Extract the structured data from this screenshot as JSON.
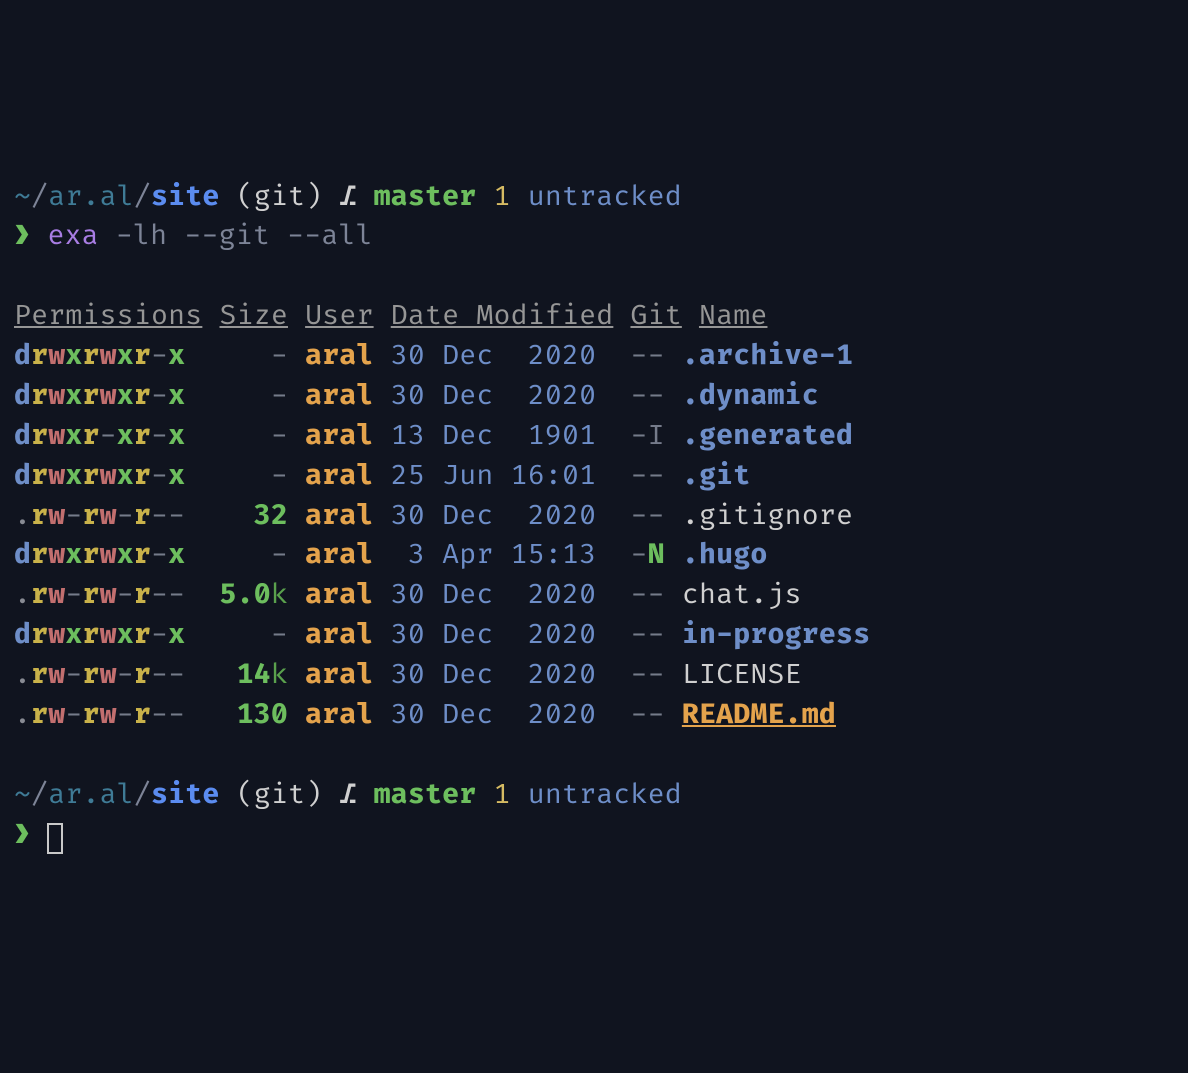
{
  "prompt1": {
    "tilde": "~",
    "slash1": "/",
    "path_mid": "ar.al",
    "slash2": "/",
    "dir": "site",
    "lparen": " (",
    "git": "git",
    "rparen": ")",
    "branch_icon": " ⎇ ",
    "branch": "master",
    "count": " 1 ",
    "untracked": "untracked"
  },
  "command": {
    "chevron": "❯",
    "exa": "exa",
    "flags": " -lh --git --all"
  },
  "headers": {
    "perm": "Permissions",
    "size": "Size",
    "user": "User",
    "date": "Date Modified",
    "git": "Git",
    "name": "Name"
  },
  "rows": [
    {
      "perm": "drwxrwxr-x",
      "size": "-",
      "unit": "",
      "user": "aral",
      "date": "30 Dec  2020",
      "git": "--",
      "name": ".archive-1",
      "kind": "dir"
    },
    {
      "perm": "drwxrwxr-x",
      "size": "-",
      "unit": "",
      "user": "aral",
      "date": "30 Dec  2020",
      "git": "--",
      "name": ".dynamic",
      "kind": "dir"
    },
    {
      "perm": "drwxr-xr-x",
      "size": "-",
      "unit": "",
      "user": "aral",
      "date": "13 Dec  1901",
      "git": "-I",
      "name": ".generated",
      "kind": "dir"
    },
    {
      "perm": "drwxrwxr-x",
      "size": "-",
      "unit": "",
      "user": "aral",
      "date": "25 Jun 16:01",
      "git": "--",
      "name": ".git",
      "kind": "dir"
    },
    {
      "perm": ".rw-rw-r--",
      "size": "32",
      "unit": "",
      "user": "aral",
      "date": "30 Dec  2020",
      "git": "--",
      "name": ".gitignore",
      "kind": "file"
    },
    {
      "perm": "drwxrwxr-x",
      "size": "-",
      "unit": "",
      "user": "aral",
      "date": " 3 Apr 15:13",
      "git": "-N",
      "name": ".hugo",
      "kind": "dir"
    },
    {
      "perm": ".rw-rw-r--",
      "size": "5.0",
      "unit": "k",
      "user": "aral",
      "date": "30 Dec  2020",
      "git": "--",
      "name": "chat.js",
      "kind": "file"
    },
    {
      "perm": "drwxrwxr-x",
      "size": "-",
      "unit": "",
      "user": "aral",
      "date": "30 Dec  2020",
      "git": "--",
      "name": "in-progress",
      "kind": "dir"
    },
    {
      "perm": ".rw-rw-r--",
      "size": "14",
      "unit": "k",
      "user": "aral",
      "date": "30 Dec  2020",
      "git": "--",
      "name": "LICENSE",
      "kind": "file"
    },
    {
      "perm": ".rw-rw-r--",
      "size": "130",
      "unit": "",
      "user": "aral",
      "date": "30 Dec  2020",
      "git": "--",
      "name": "README.md",
      "kind": "readme"
    }
  ],
  "prompt2": {
    "tilde": "~",
    "slash1": "/",
    "path_mid": "ar.al",
    "slash2": "/",
    "dir": "site",
    "lparen": " (",
    "git": "git",
    "rparen": ")",
    "branch_icon": " ⎇ ",
    "branch": "master",
    "count": " 1 ",
    "untracked": "untracked",
    "chevron": "❯"
  }
}
